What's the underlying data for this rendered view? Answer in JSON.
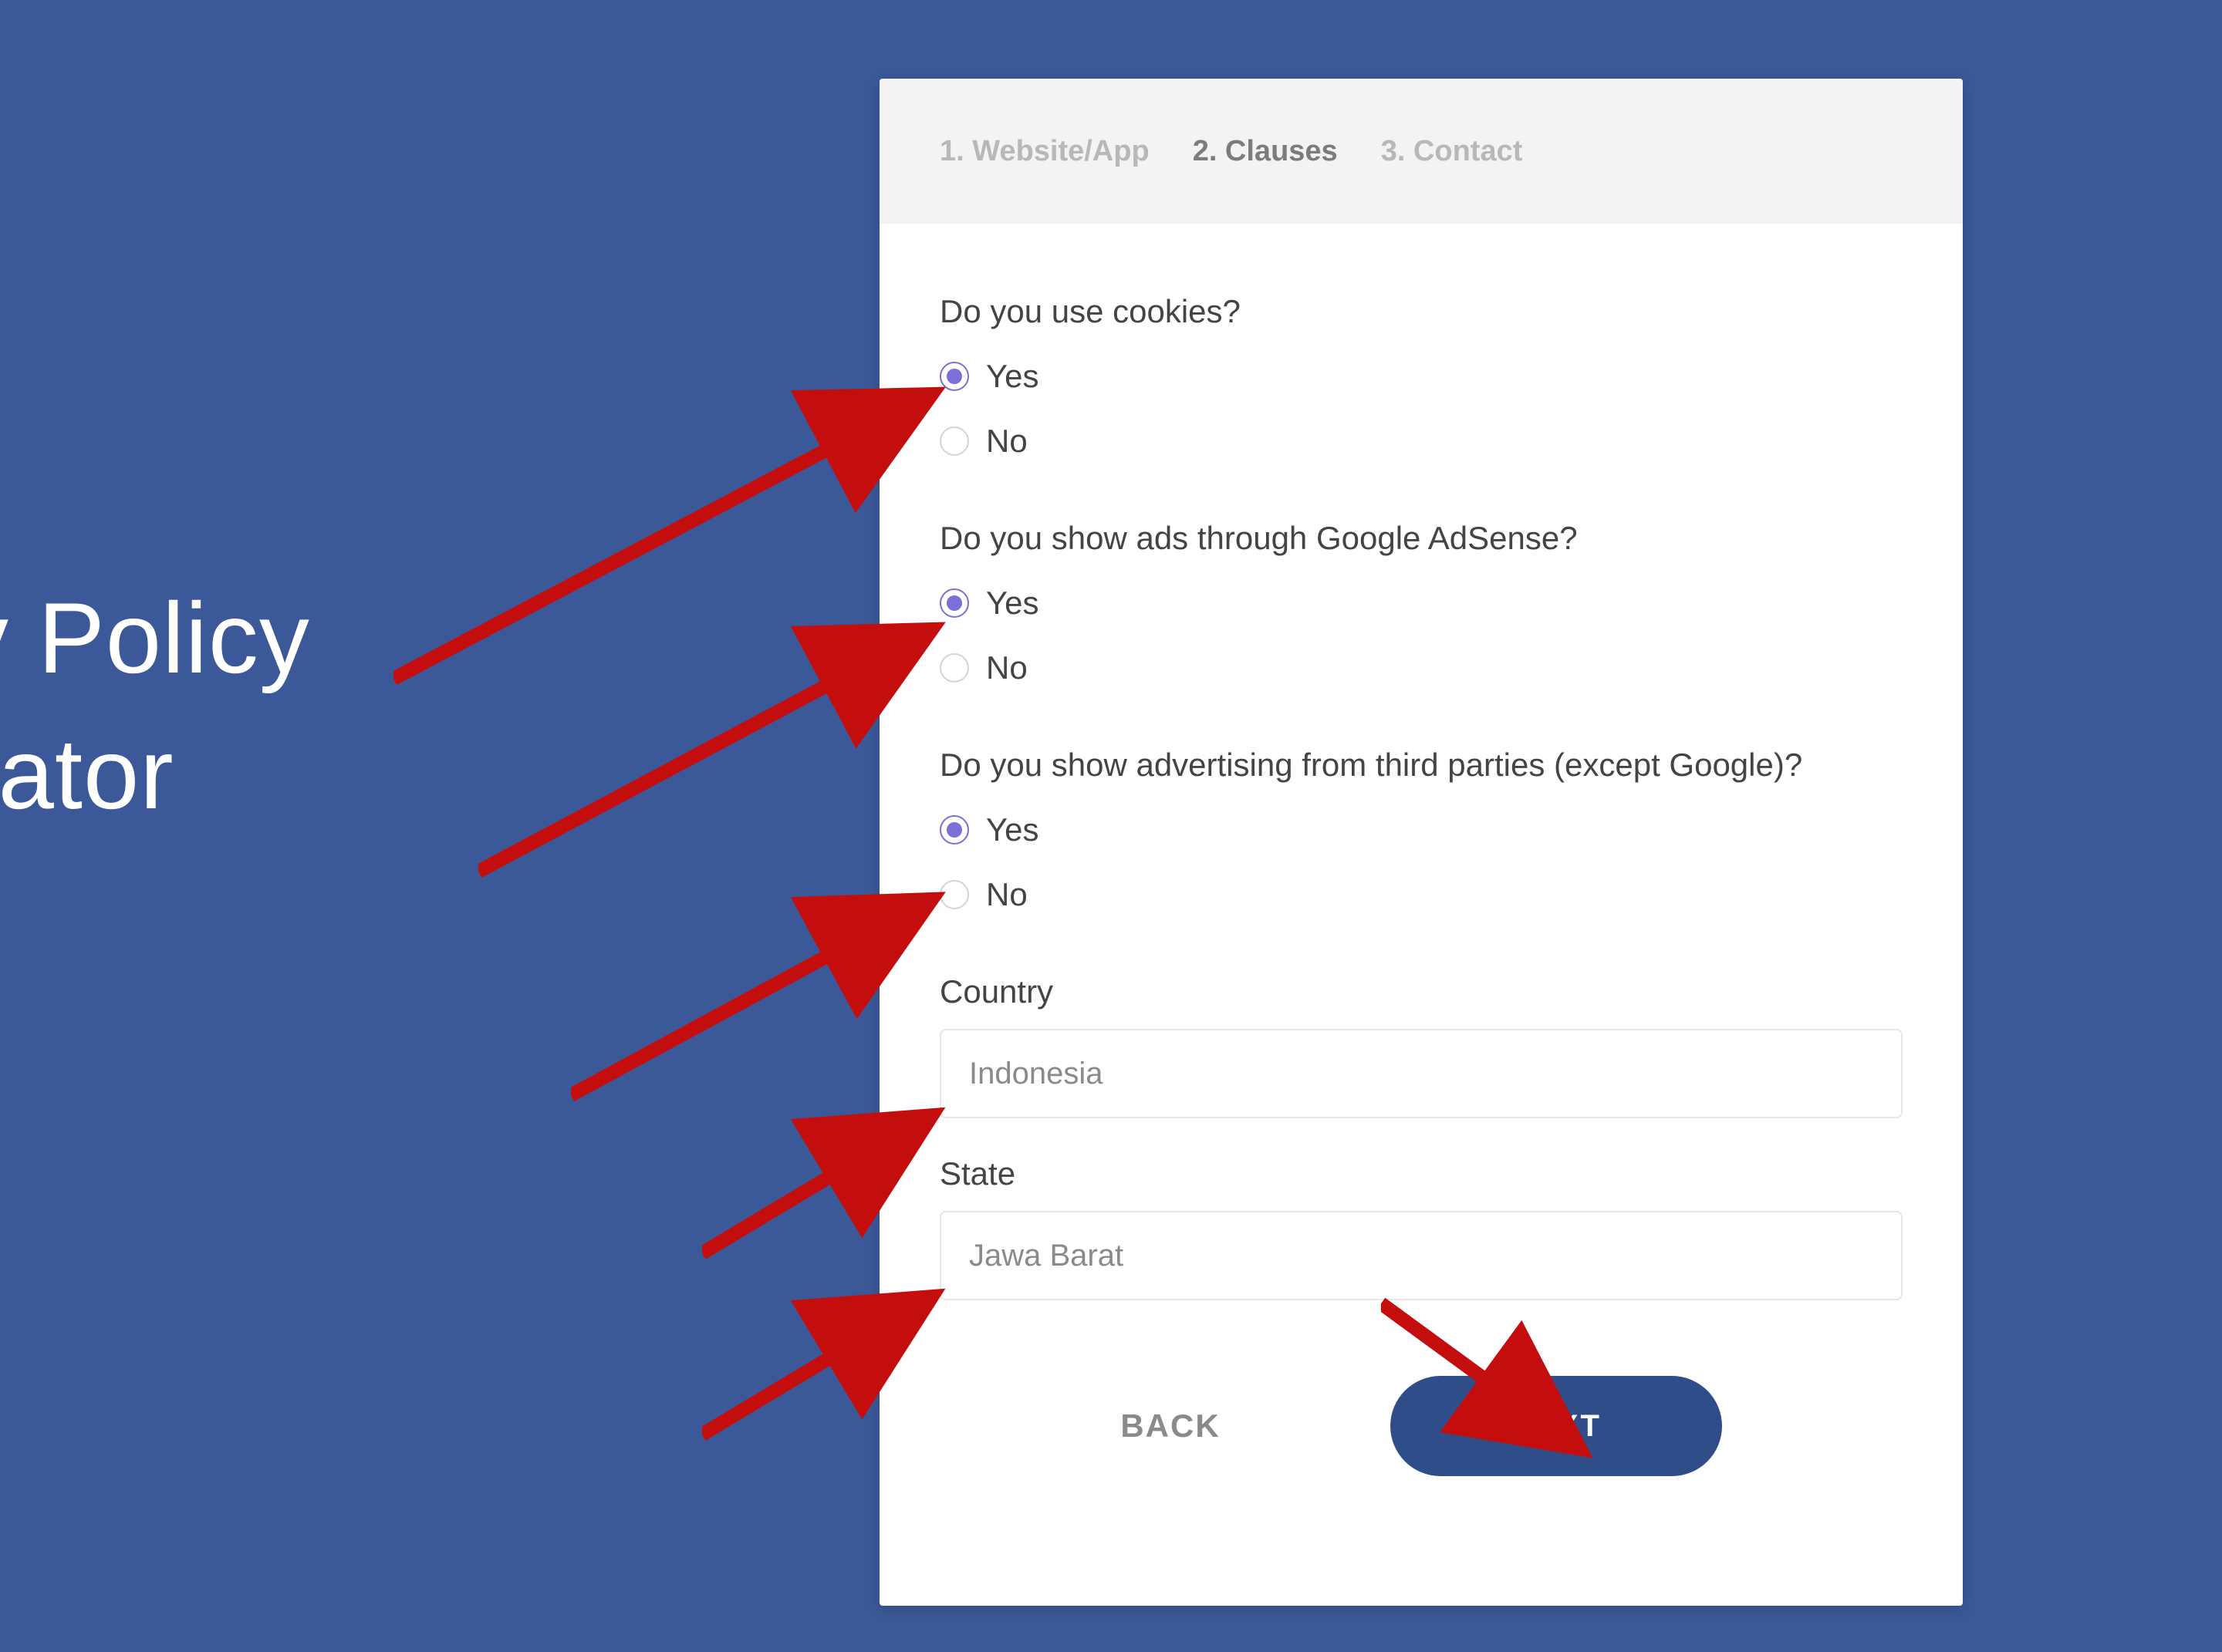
{
  "background_title": {
    "line1": "cy Policy",
    "line2": "erator"
  },
  "steps": [
    {
      "label": "1. Website/App",
      "active": false
    },
    {
      "label": "2. Clauses",
      "active": true
    },
    {
      "label": "3. Contact",
      "active": false
    }
  ],
  "questions": {
    "cookies": {
      "text": "Do you use cookies?",
      "options": {
        "yes": "Yes",
        "no": "No"
      },
      "selected": "yes"
    },
    "adsense": {
      "text": "Do you show ads through Google AdSense?",
      "options": {
        "yes": "Yes",
        "no": "No"
      },
      "selected": "yes"
    },
    "thirdparty": {
      "text": "Do you show advertising from third parties (except Google)?",
      "options": {
        "yes": "Yes",
        "no": "No"
      },
      "selected": "yes"
    }
  },
  "fields": {
    "country": {
      "label": "Country",
      "value": "Indonesia"
    },
    "state": {
      "label": "State",
      "value": "Jawa Barat"
    }
  },
  "actions": {
    "back": "BACK",
    "next": "NEXT"
  },
  "colors": {
    "background": "#3b5998",
    "radio_selected": "#7b6fd8",
    "next_button": "#2f4d89",
    "arrow": "#c40e0e"
  }
}
